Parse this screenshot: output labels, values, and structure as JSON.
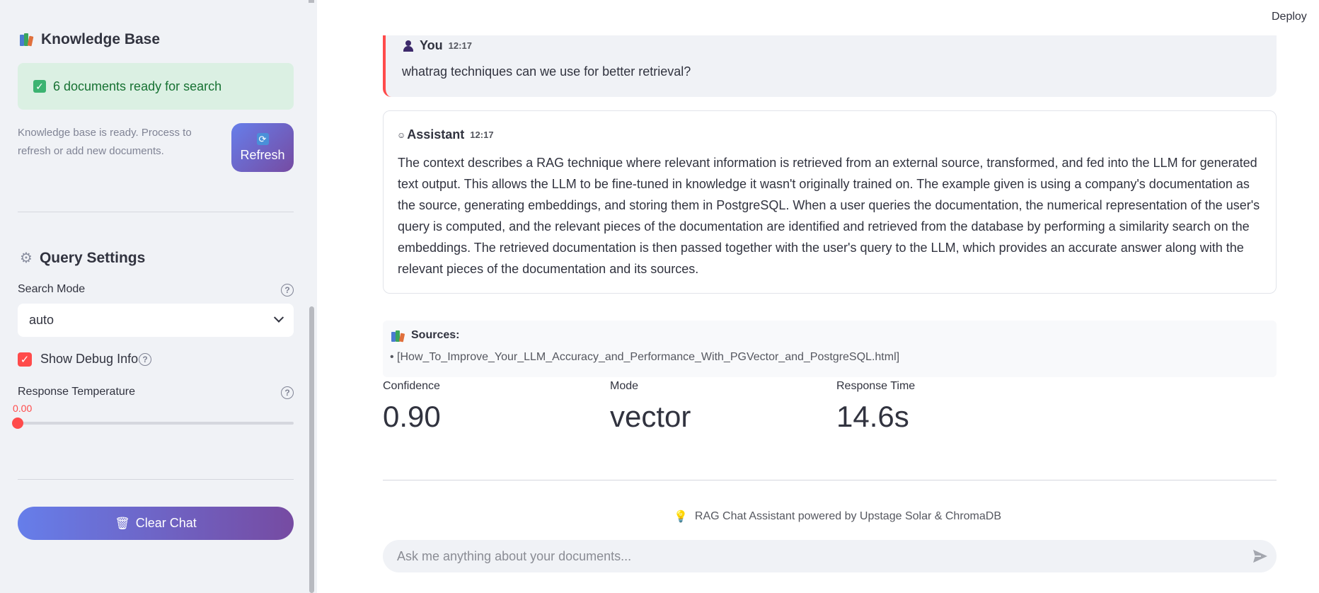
{
  "app": {
    "deploy_label": "Deploy"
  },
  "sidebar": {
    "kb_title": "Knowledge Base",
    "status_text": "6 documents ready for search",
    "kb_note": "Knowledge base is ready. Process to refresh or add new documents.",
    "refresh_label": "Refresh",
    "query_title": "Query Settings",
    "search_mode_label": "Search Mode",
    "search_mode_value": "auto",
    "debug_label": "Show Debug Info",
    "debug_checked": true,
    "temp_label": "Response Temperature",
    "temp_value": "0.00",
    "clear_label": "Clear Chat"
  },
  "chat": {
    "user": {
      "name": "You",
      "time": "12:17",
      "text": "whatrag techniques can we use for better retrieval?"
    },
    "assistant": {
      "name": "Assistant",
      "time": "12:17",
      "text": "The context describes a RAG technique where relevant information is retrieved from an external source, transformed, and fed into the LLM for generated text output. This allows the LLM to be fine-tuned in knowledge it wasn't originally trained on. The example given is using a company's documentation as the source, generating embeddings, and storing them in PostgreSQL. When a user queries the documentation, the numerical representation of the user's query is computed, and the relevant pieces of the documentation are identified and retrieved from the database by performing a similarity search on the embeddings. The retrieved documentation is then passed together with the user's query to the LLM, which provides an accurate answer along with the relevant pieces of the documentation and its sources."
    },
    "sources_title": "Sources:",
    "sources": [
      "• [How_To_Improve_Your_LLM_Accuracy_and_Performance_With_PGVector_and_PostgreSQL.html]"
    ],
    "metrics": [
      {
        "label": "Confidence",
        "value": "0.90"
      },
      {
        "label": "Mode",
        "value": "vector"
      },
      {
        "label": "Response Time",
        "value": "14.6s"
      }
    ],
    "footer_text": "RAG Chat Assistant powered by Upstage Solar & ChromaDB",
    "input_placeholder": "Ask me anything about your documents..."
  },
  "colors": {
    "accent": "#ff4b4b",
    "gradient_start": "#667eea",
    "gradient_end": "#764ba2",
    "success_bg": "#dbf0e3"
  }
}
